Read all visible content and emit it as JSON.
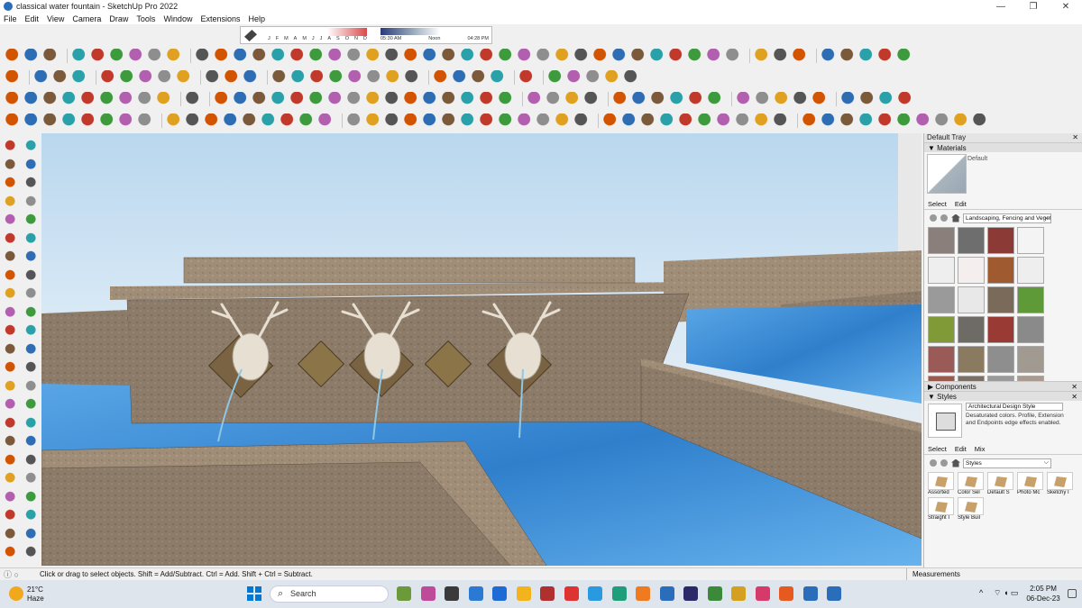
{
  "window": {
    "title": "classical water fountain - SketchUp Pro 2022",
    "controls": [
      "—",
      "❐",
      "✕"
    ]
  },
  "menu": [
    "File",
    "Edit",
    "View",
    "Camera",
    "Draw",
    "Tools",
    "Window",
    "Extensions",
    "Help"
  ],
  "shadow": {
    "months": [
      "J",
      "F",
      "M",
      "A",
      "M",
      "J",
      "J",
      "A",
      "S",
      "O",
      "N",
      "D"
    ],
    "time_start": "05:30 AM",
    "time_mid": "Noon",
    "time_end": "04:28 PM"
  },
  "tray": {
    "title": "Default Tray",
    "close": "✕",
    "materials": {
      "header": "▼ Materials",
      "current": "Default",
      "tab_select": "Select",
      "tab_edit": "Edit",
      "collection": "Landscaping, Fencing and Vegetation"
    },
    "components": {
      "header": "▶ Components"
    },
    "styles": {
      "header": "▼ Styles",
      "current": "Architectural Design Style",
      "description": "Desaturated colors. Profile, Extension and Endpoints edge effects enabled.",
      "tab_select": "Select",
      "tab_edit": "Edit",
      "tab_mix": "Mix",
      "collection": "Styles",
      "items": [
        "Assorted",
        "Color Sel",
        "Default S",
        "Photo Mc",
        "Sketchy I",
        "Straight I",
        "Style Buil"
      ]
    }
  },
  "status": {
    "icons": "ⓘ ○",
    "message": "Click or drag to select objects. Shift = Add/Subtract. Ctrl = Add. Shift + Ctrl = Subtract.",
    "measurements_label": "Measurements"
  },
  "taskbar": {
    "temperature": "21°C",
    "condition": "Haze",
    "search_label": "Search",
    "time": "2:05 PM",
    "date": "06-Dec-23",
    "tray_chevron": "^",
    "tray_icons": "⌔ ◖ ▭"
  },
  "colors": {
    "toolbar_bg": "#f0f0f0",
    "sky_top": "#b9d7ee",
    "stone": "#8b7a68",
    "water": "#3a8fd6",
    "taskbar": "#dfe5ec"
  }
}
